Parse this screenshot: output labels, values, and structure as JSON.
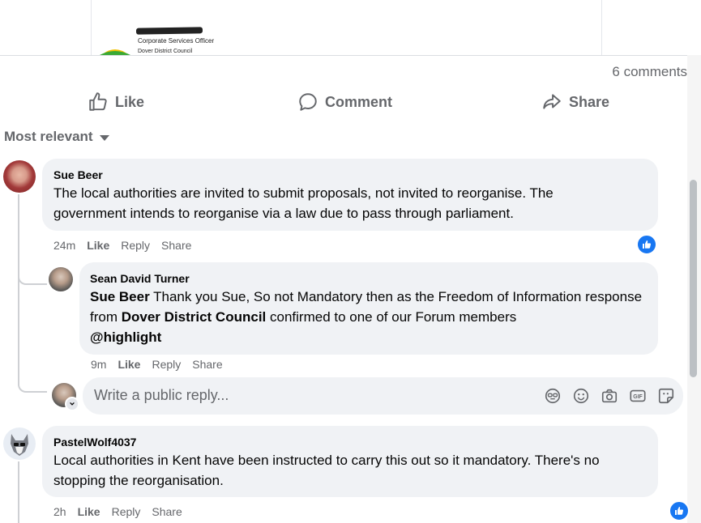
{
  "attachment": {
    "officer_title": "Corporate Services Officer",
    "officer_org": "Dover District Council"
  },
  "post": {
    "comments_count": "6 comments",
    "actions": {
      "like": "Like",
      "comment": "Comment",
      "share": "Share"
    },
    "sort_label": "Most relevant"
  },
  "comments": [
    {
      "author": "Sue Beer",
      "text": "The local authorities are invited to submit proposals, not invited to reorganise. The government intends to reorganise via a law due to pass through parliament.",
      "time": "24m",
      "like": "Like",
      "reply": "Reply",
      "share": "Share",
      "reaction": "like-icon",
      "replies": [
        {
          "author": "Sean David Turner",
          "mention": "Sue Beer",
          "text_part1": " Thank you Sue, So not Mandatory then as the Freedom of Information response from ",
          "bold_org": "Dover District Council",
          "text_part2": " confirmed to one of our Forum members",
          "tag": "@highlight",
          "time": "9m",
          "like": "Like",
          "reply": "Reply",
          "share": "Share"
        }
      ]
    },
    {
      "author": "PastelWolf4037",
      "text": "Local authorities in Kent have been instructed to carry this out so it mandatory. There's no stopping the reorganisation.",
      "time": "2h",
      "like": "Like",
      "reply": "Reply",
      "share": "Share",
      "reaction": "like-icon"
    }
  ],
  "reply_box": {
    "placeholder": "Write a public reply...",
    "tools": [
      "avatar-sticker-icon",
      "emoji-icon",
      "camera-icon",
      "gif-icon",
      "sticker-icon"
    ]
  },
  "colors": {
    "accent": "#1877f2",
    "bubble": "#f0f2f5",
    "secondary_text": "#65676b"
  }
}
